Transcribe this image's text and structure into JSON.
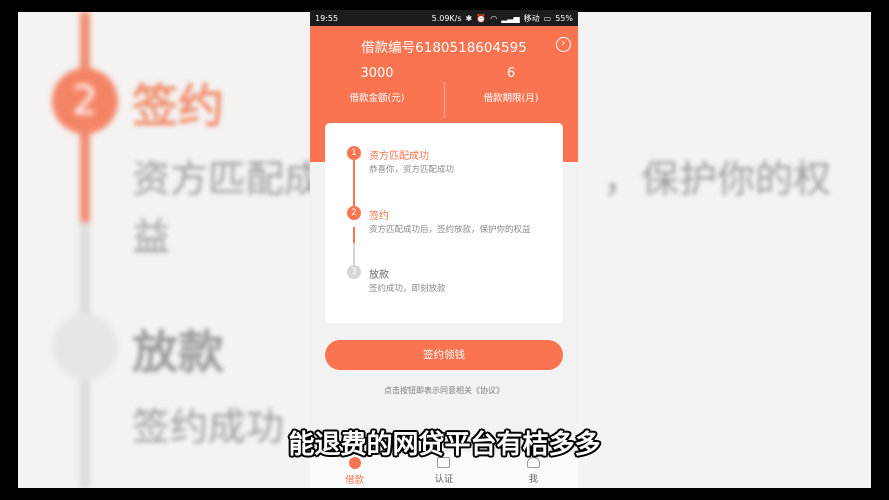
{
  "backdrop": {
    "step1_number": "2",
    "step1_title": "签约",
    "line1_left": "资方匹配成",
    "line1_right": "，保护你的权",
    "line2": "益",
    "step2_title": "放款",
    "line3": "签约成功"
  },
  "status_bar": {
    "time": "19:55",
    "speed": "5.09K/s",
    "carrier": "移动",
    "battery": "55%"
  },
  "header": {
    "title": "借款编号6180518604595",
    "amount_value": "3000",
    "amount_label": "借款金额(元)",
    "term_value": "6",
    "term_label": "借款期限(月)"
  },
  "steps": [
    {
      "number": "1",
      "title": "资方匹配成功",
      "desc": "恭喜你，资方匹配成功",
      "state": "done"
    },
    {
      "number": "2",
      "title": "签约",
      "desc": "资方匹配成功后，签约放款，保护你的权益",
      "state": "active"
    },
    {
      "number": "3",
      "title": "放款",
      "desc": "签约成功，即刻放款",
      "state": "pending"
    }
  ],
  "actions": {
    "sign_button": "签约领钱",
    "agreement_text": "点击按钮即表示同意相关《协议》"
  },
  "tabbar": [
    {
      "label": "借款",
      "active": true
    },
    {
      "label": "认证",
      "active": false
    },
    {
      "label": "我",
      "active": false
    }
  ],
  "subtitle": "能退费的网贷平台有桔多多",
  "colors": {
    "accent": "#fb7451",
    "pending": "#d6d6d6",
    "backdrop": "#f4f3f2"
  }
}
